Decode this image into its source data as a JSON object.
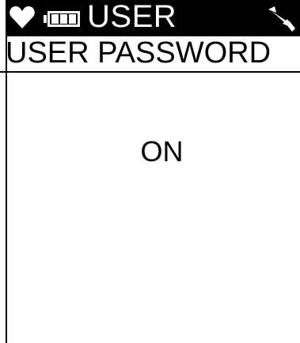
{
  "status_bar": {
    "mode_label": "USER",
    "icons": [
      "heart-icon",
      "battery-icon",
      "wrench-icon"
    ]
  },
  "screen": {
    "title": "USER PASSWORD",
    "value": "ON"
  },
  "colors": {
    "background": "#ffffff",
    "header_bg": "#000000",
    "text": "#000000"
  }
}
